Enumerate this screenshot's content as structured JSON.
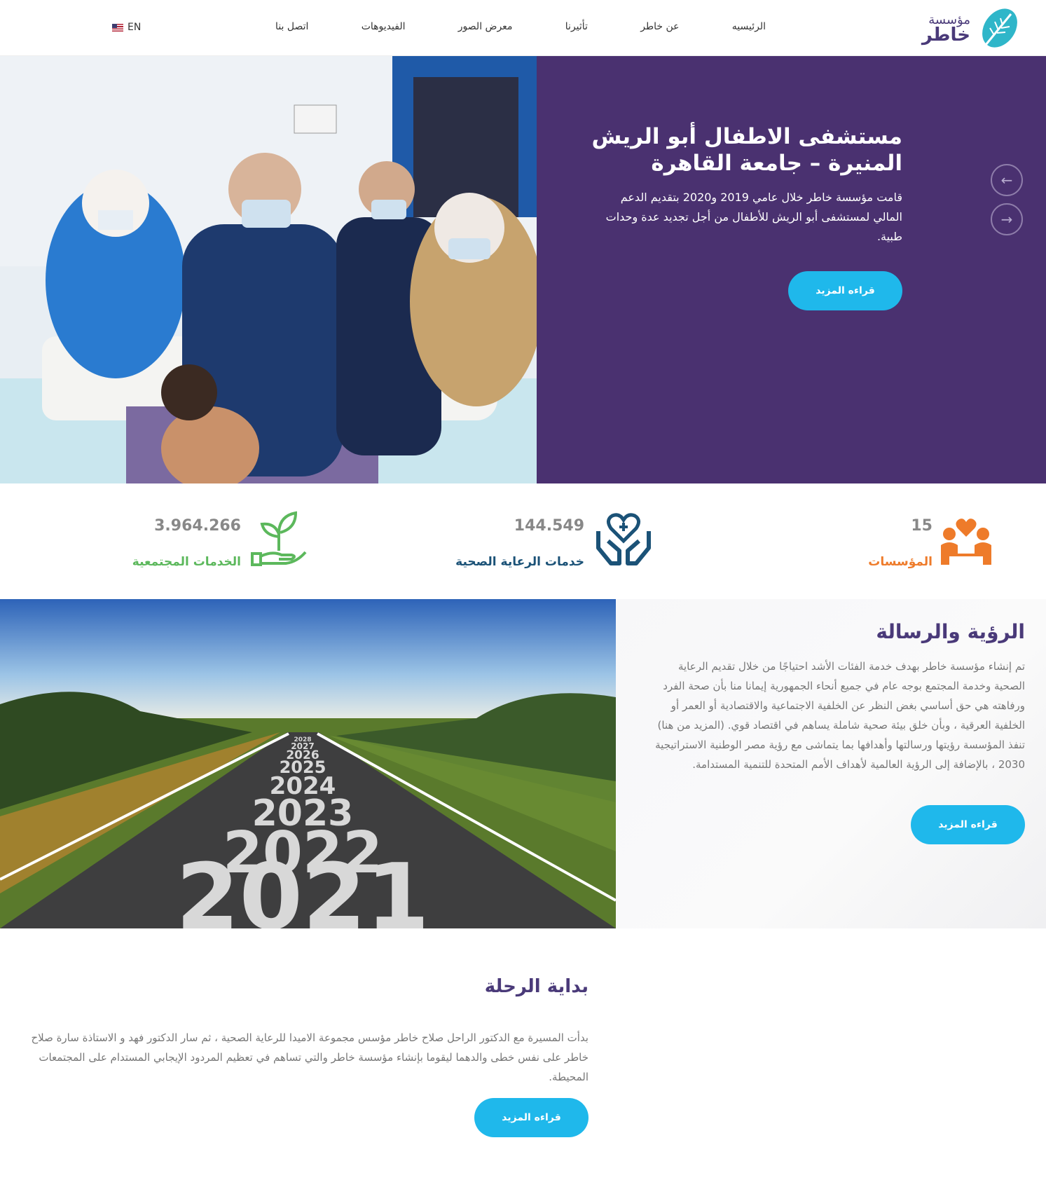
{
  "brand": {
    "top": "مؤسسة",
    "bottom": "خاطر",
    "accent": "#1fb8eb",
    "purple": "#4a3170"
  },
  "nav": {
    "items": [
      {
        "label": "الرئيسيه"
      },
      {
        "label": "عن خاطر"
      },
      {
        "label": "تأثيرنا"
      },
      {
        "label": "معرض الصور"
      },
      {
        "label": "الفيديوهات"
      },
      {
        "label": "اتصل بنا"
      }
    ],
    "lang": "EN"
  },
  "hero": {
    "title": "مستشفى الاطفال أبو الريش المنيرة – جامعة القاهرة",
    "text": "قامت مؤسسة خاطر خلال عامي 2019 و2020 بتقديم الدعم المالي لمستشفى أبو الريش للأطفال من أجل تجديد عدة وحدات طبية.",
    "button": "قراءه المزيد",
    "prev_icon": "arrow-left-icon",
    "next_icon": "arrow-right-icon"
  },
  "stats": {
    "institutions": {
      "value": "15",
      "label": "المؤسسات",
      "color": "#ee7b2a"
    },
    "healthcare": {
      "value": "144.549",
      "label": "خدمات الرعاية الصحية",
      "color": "#1b5277"
    },
    "community": {
      "value": "3.964.266",
      "label": "الخدمات المجتمعية",
      "color": "#5cb85c"
    }
  },
  "vision": {
    "title": "الرؤية والرسالة",
    "text": "تم إنشاء مؤسسة خاطر بهدف خدمة الفئات الأشد احتياجًا من خلال تقديم الرعاية الصحية وخدمة المجتمع بوجه عام في جميع أنحاء الجمهورية إيمانا منا بأن صحة الفرد ورفاهته هي حق أساسي بغض النظر عن الخلفية الاجتماعية والاقتصادية أو العمر أو الخلفية العرقية ، وبأن خلق بيئة صحية شاملة يساهم في اقتصاد قوي. (المزيد من هنا) تنفذ المؤسسة رؤيتها ورسالتها وأهدافها بما يتماشى مع رؤية مصر الوطنية الاستراتيجية 2030 ، بالإضافة إلى الرؤية العالمية لأهداف الأمم المتحدة للتنمية المستدامة.",
    "button": "قراءه المزيد"
  },
  "road": {
    "years": [
      "2021",
      "2022",
      "2023",
      "2024",
      "2025",
      "2026",
      "2027",
      "2028"
    ]
  },
  "journey": {
    "title": "بداية الرحلة",
    "text": "بدأت المسيرة مع الدكتور الراحل صلاح خاطر مؤسس مجموعة الاميدا للرعاية الصحية ، ثم سار الدكتور فهد و الاستاذة سارة صلاح خاطر على نفس خطى والدهما ليقوما بإنشاء مؤسسة خاطر والتي تساهم في تعظيم المردود الإيجابي المستدام على المجتمعات المحيطة.",
    "button": "قراءه المزيد"
  }
}
